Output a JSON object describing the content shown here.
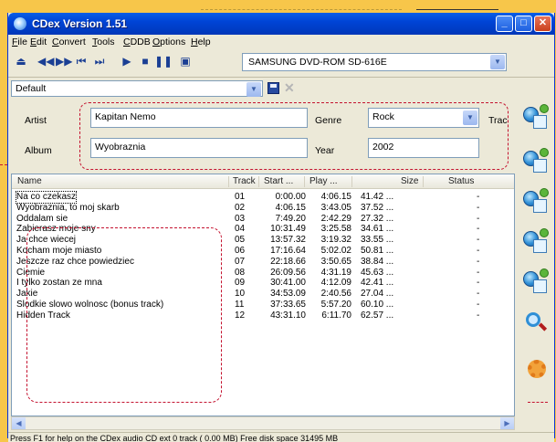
{
  "window": {
    "title": "CDex Version 1.51"
  },
  "menu": [
    "File",
    "Edit",
    "Convert",
    "Tools",
    "CDDB",
    "Options",
    "Help"
  ],
  "toolbar": {
    "drive": "SAMSUNG DVD-ROM SD-616E",
    "profile": "Default"
  },
  "album": {
    "artist_label": "Artist",
    "artist": "Kapitan Nemo",
    "album_label": "Album",
    "album": "Wyobraznia",
    "genre_label": "Genre",
    "genre": "Rock",
    "track_label": "Trac",
    "year_label": "Year",
    "year": "2002"
  },
  "columns": [
    "Name",
    "Track",
    "Start ...",
    "Play ...",
    "Size",
    "Status"
  ],
  "tracks": [
    {
      "name": "Na co czekasz",
      "track": "01",
      "start": "0:00.00",
      "play": "4:06.15",
      "size": "41.42 ...",
      "status": "-"
    },
    {
      "name": "Wyobraznia, to moj skarb",
      "track": "02",
      "start": "4:06.15",
      "play": "3:43.05",
      "size": "37.52 ...",
      "status": "-"
    },
    {
      "name": "Oddalam sie",
      "track": "03",
      "start": "7:49.20",
      "play": "2:42.29",
      "size": "27.32 ...",
      "status": "-"
    },
    {
      "name": "Zabierasz moje sny",
      "track": "04",
      "start": "10:31.49",
      "play": "3:25.58",
      "size": "34.61 ...",
      "status": "-"
    },
    {
      "name": "Ja chce wiecej",
      "track": "05",
      "start": "13:57.32",
      "play": "3:19.32",
      "size": "33.55 ...",
      "status": "-"
    },
    {
      "name": "Kocham moje miasto",
      "track": "06",
      "start": "17:16.64",
      "play": "5:02.02",
      "size": "50.81 ...",
      "status": "-"
    },
    {
      "name": "Jeszcze raz chce powiedziec",
      "track": "07",
      "start": "22:18.66",
      "play": "3:50.65",
      "size": "38.84 ...",
      "status": "-"
    },
    {
      "name": "Ciemie",
      "track": "08",
      "start": "26:09.56",
      "play": "4:31.19",
      "size": "45.63 ...",
      "status": "-"
    },
    {
      "name": "I tylko zostan ze mna",
      "track": "09",
      "start": "30:41.00",
      "play": "4:12.09",
      "size": "42.41 ...",
      "status": "-"
    },
    {
      "name": "Jakie",
      "track": "10",
      "start": "34:53.09",
      "play": "2:40.56",
      "size": "27.04 ...",
      "status": "-"
    },
    {
      "name": "Slodkie slowo wolnosc (bonus track)",
      "track": "11",
      "start": "37:33.65",
      "play": "5:57.20",
      "size": "60.10 ...",
      "status": "-"
    },
    {
      "name": "Hidden Track",
      "track": "12",
      "start": "43:31.10",
      "play": "6:11.70",
      "size": "62.57 ...",
      "status": "-"
    }
  ],
  "status": "Press F1 for help on the CDex audio CD ext  0 track ( 0.00 MB) Free disk space 31495 MB",
  "side_icons": [
    "read-cddb-icon",
    "read-cdtext-icon",
    "submit-cddb-icon",
    "track-info-icon",
    "rename-icon",
    "search-icon",
    "settings-icon"
  ],
  "colors": {
    "titlebar": "#0044d6",
    "highlight": "#c4122f",
    "background": "#f7c64a"
  }
}
